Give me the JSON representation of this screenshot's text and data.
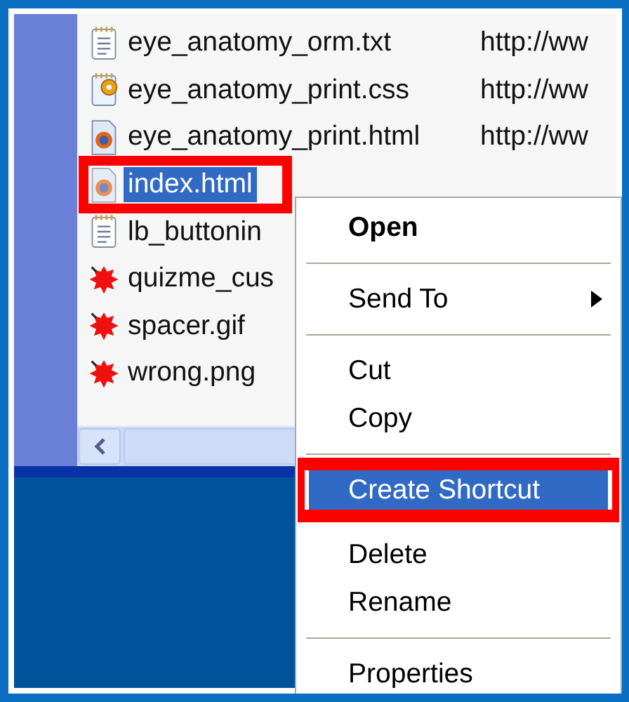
{
  "files": [
    {
      "name": "eye_anatomy_orm.txt",
      "kind": "text",
      "url": "http://ww",
      "selected": false
    },
    {
      "name": "eye_anatomy_print.css",
      "kind": "css",
      "url": "http://ww",
      "selected": false
    },
    {
      "name": "eye_anatomy_print.html",
      "kind": "html",
      "url": "http://ww",
      "selected": false
    },
    {
      "name": "index.html",
      "kind": "html",
      "selected": true
    },
    {
      "name": "lb_buttonin",
      "kind": "text",
      "selected": false
    },
    {
      "name": "quizme_cus",
      "kind": "broken",
      "selected": false
    },
    {
      "name": "spacer.gif",
      "kind": "broken",
      "selected": false
    },
    {
      "name": "wrong.png",
      "kind": "broken",
      "selected": false
    }
  ],
  "context_menu": [
    {
      "kind": "item",
      "label": "Open",
      "bold": true,
      "submenu": false,
      "selected": false
    },
    {
      "kind": "separator"
    },
    {
      "kind": "item",
      "label": "Send To",
      "bold": false,
      "submenu": true,
      "selected": false
    },
    {
      "kind": "separator"
    },
    {
      "kind": "item",
      "label": "Cut",
      "bold": false,
      "submenu": false,
      "selected": false
    },
    {
      "kind": "item",
      "label": "Copy",
      "bold": false,
      "submenu": false,
      "selected": false
    },
    {
      "kind": "separator"
    },
    {
      "kind": "item",
      "label": "Create Shortcut",
      "bold": false,
      "submenu": false,
      "selected": true
    },
    {
      "kind": "item",
      "label": "Delete",
      "bold": false,
      "submenu": false,
      "selected": false
    },
    {
      "kind": "item",
      "label": "Rename",
      "bold": false,
      "submenu": false,
      "selected": false
    },
    {
      "kind": "separator"
    },
    {
      "kind": "item",
      "label": "Properties",
      "bold": false,
      "submenu": false,
      "selected": false
    }
  ]
}
